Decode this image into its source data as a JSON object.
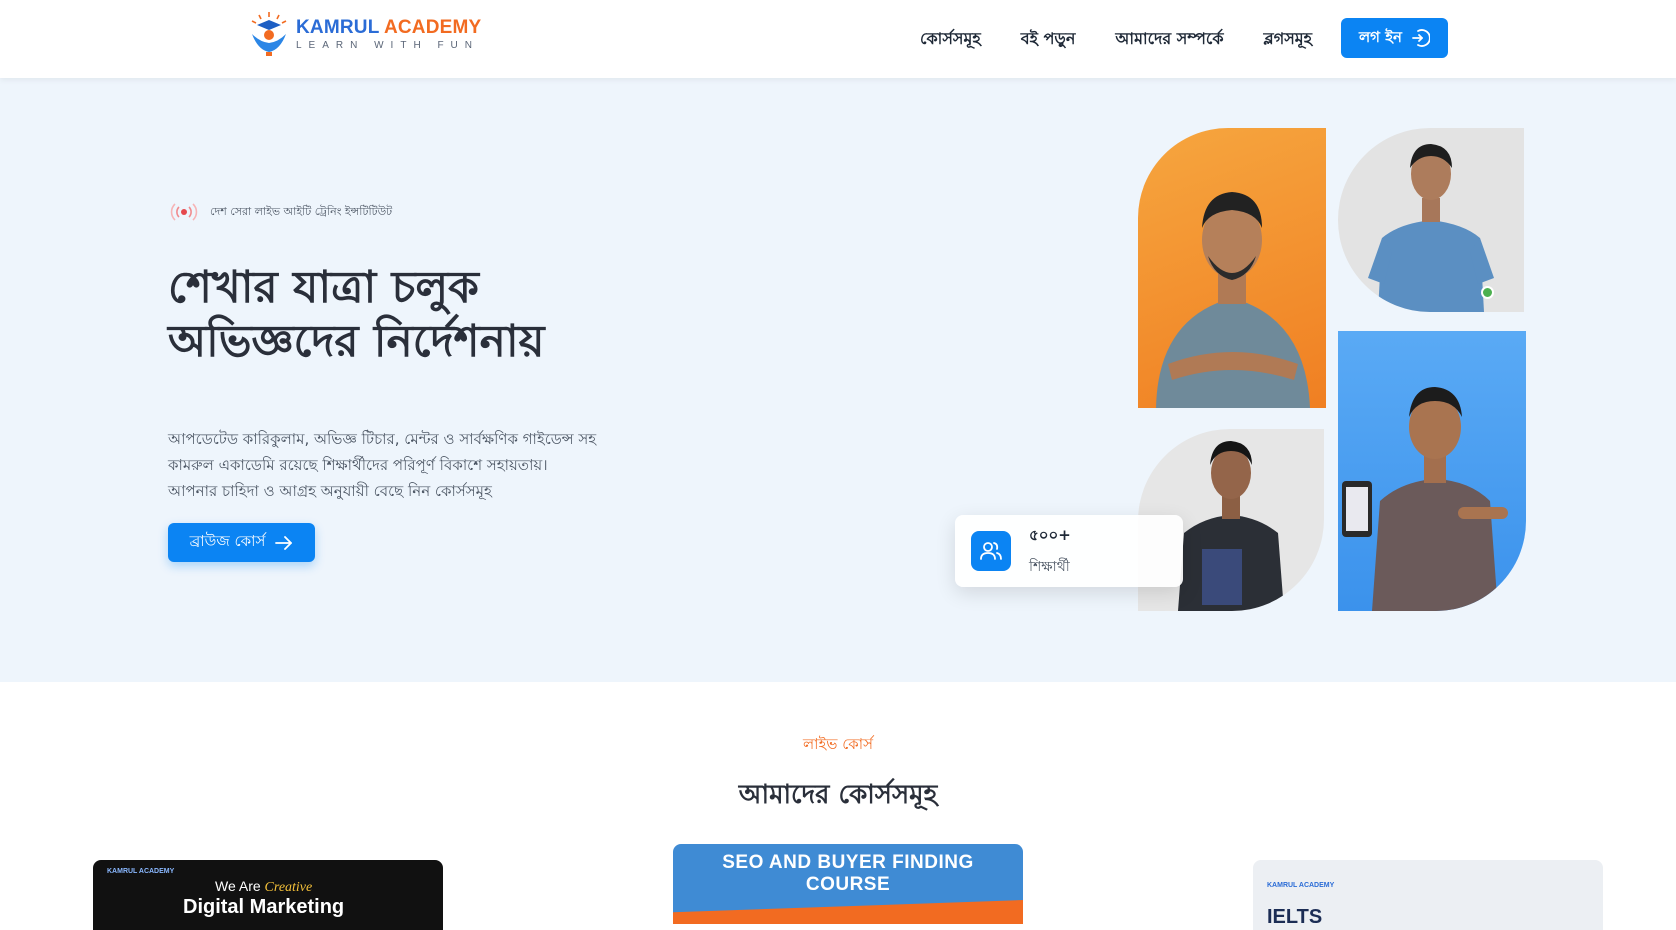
{
  "brand": {
    "name_primary": "KAMRUL",
    "name_secondary": "ACADEMY",
    "tagline": "LEARN WITH FUN"
  },
  "nav": {
    "items": [
      {
        "label": "কোর্সসমূহ"
      },
      {
        "label": "বই পড়ুন"
      },
      {
        "label": "আমাদের সম্পর্কে"
      },
      {
        "label": "ব্লগসমূহ"
      }
    ],
    "login_label": "লগ ইন"
  },
  "hero": {
    "badge": "দেশ সেরা লাইভ আইটি ট্রেনিং ইন্সটিটিউট",
    "title_line1": "শেখার যাত্রা চলুক",
    "title_line2": "অভিজ্ঞদের নির্দেশনায়",
    "desc_line1": "আপডেটেড কারিকুলাম, অভিজ্ঞ টিচার, মেন্টর ও সার্বক্ষণিক গাইডেন্স সহ",
    "desc_line2": "কামরুল একাডেমি রয়েছে শিক্ষার্থীদের পরিপূর্ণ বিকাশে সহায়তায়।",
    "desc_line3": "আপনার চাহিদা ও আগ্রহ অনুযায়ী বেছে নিন কোর্সসমূহ",
    "browse_label": "ব্রাউজ কোর্স",
    "stat_value": "৫০০+",
    "stat_label": "শিক্ষার্থী"
  },
  "courses_section": {
    "kicker": "লাইভ কোর্স",
    "title": "আমাদের কোর্সসমূহ",
    "cards": [
      {
        "brand": "KAMRUL ACADEMY",
        "line_a": "We Are",
        "line_a_accent": "Creative",
        "line_b": "Digital Marketing"
      },
      {
        "title_line1": "SEO AND BUYER FINDING",
        "title_line2": "COURSE"
      },
      {
        "brand": "KAMRUL ACADEMY",
        "title": "IELTS"
      }
    ]
  },
  "colors": {
    "primary": "#0b84f3",
    "accent": "#f26b21",
    "hero_bg": "#eef5fc"
  }
}
